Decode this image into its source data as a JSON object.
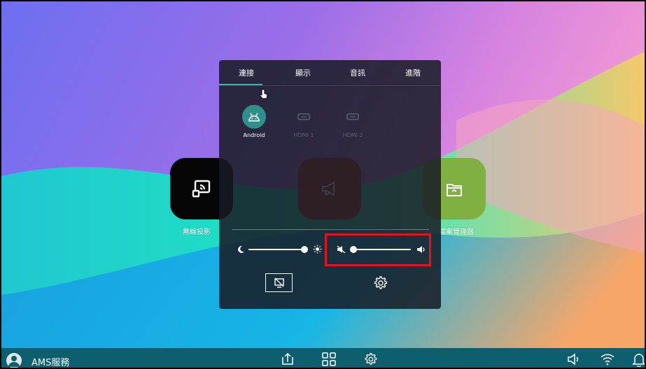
{
  "colors": {
    "accent": "#3bb3a9",
    "highlight": "#e0151b",
    "taskbar": "#0d5f6e",
    "panel": "#171b24"
  },
  "panel": {
    "tabs": [
      {
        "label": "連接",
        "selected": true
      },
      {
        "label": "顯示"
      },
      {
        "label": "音訊"
      },
      {
        "label": "進階"
      }
    ],
    "sources": [
      {
        "label": "Android",
        "icon": "android-icon",
        "active": true
      },
      {
        "label": "HDMI 1",
        "icon": "hdmi-icon"
      },
      {
        "label": "HDMI 2",
        "icon": "hdmi-icon"
      }
    ],
    "brightness": {
      "level": 1.0,
      "icon_low": "moon-icon",
      "icon_high": "sun-icon"
    },
    "volume": {
      "level": 0.0,
      "icon_mute": "mute-icon",
      "icon_high": "speaker-icon"
    }
  },
  "apps": [
    {
      "label": "無線投影",
      "icon": "cast-icon"
    },
    {
      "label": "",
      "icon": "megaphone-icon"
    },
    {
      "label": "檔案管理器",
      "icon": "folder-icon"
    }
  ],
  "taskbar": {
    "user_label": "AMS服務",
    "icons": [
      "avatar-icon",
      "share-icon",
      "apps-grid-icon",
      "gear-icon",
      "volume-icon",
      "wifi-icon",
      "bell-icon"
    ]
  }
}
